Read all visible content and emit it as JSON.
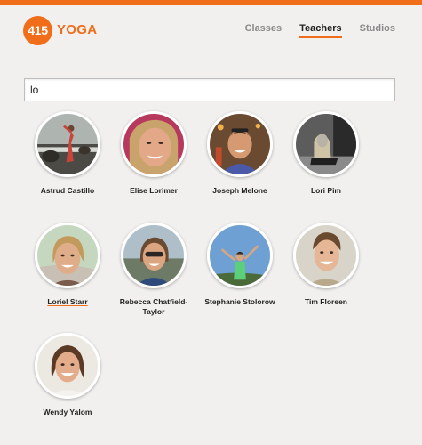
{
  "brand": {
    "number": "415",
    "word": "YOGA",
    "accent": "#f06d1a"
  },
  "nav": [
    {
      "label": "Classes",
      "active": false
    },
    {
      "label": "Teachers",
      "active": true
    },
    {
      "label": "Studios",
      "active": false
    }
  ],
  "search": {
    "value": "lo",
    "placeholder": ""
  },
  "teachers": [
    {
      "name": "Astrud Castillo",
      "photo": "beach-yoga-pose"
    },
    {
      "name": "Elise Lorimer",
      "photo": "smiling-woman-closeup"
    },
    {
      "name": "Joseph Melone",
      "photo": "smiling-man-sunglasses"
    },
    {
      "name": "Lori Pim",
      "photo": "woman-black-white"
    },
    {
      "name": "Loriel Starr",
      "photo": "woman-short-hair"
    },
    {
      "name": "Rebecca Chatfield-Taylor",
      "photo": "woman-sunglasses"
    },
    {
      "name": "Stephanie Stolorow",
      "photo": "woman-arms-raised-sky"
    },
    {
      "name": "Tim Floreen",
      "photo": "smiling-man"
    },
    {
      "name": "Wendy Yalom",
      "photo": "smiling-woman"
    }
  ]
}
